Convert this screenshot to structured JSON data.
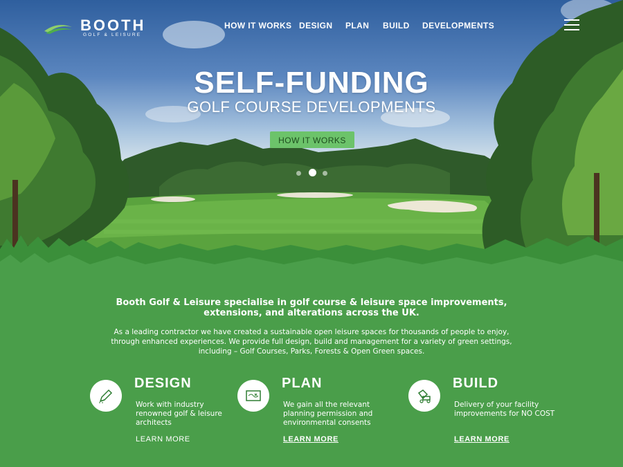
{
  "brand": {
    "name": "BOOTH",
    "tagline": "GOLF & LEISURE"
  },
  "nav": {
    "items": [
      "HOW IT WORKS",
      "DESIGN",
      "PLAN",
      "BUILD",
      "DEVELOPMENTS"
    ]
  },
  "hero": {
    "title": "SELF-FUNDING",
    "subtitle": "GOLF COURSE DEVELOPMENTS",
    "button_label": "HOW IT WORKS",
    "slides_count": 3,
    "active_slide": 2
  },
  "intro": {
    "heading": "Booth Golf & Leisure specialise in golf course & leisure space improvements, extensions, and alterations across the UK.",
    "body": "As a leading contractor we have created a sustainable open leisure spaces for thousands of people to enjoy, through enhanced experiences. We provide full design, build and management for a variety of green settings, including – Golf Courses, Parks, Forests & Open Green spaces."
  },
  "features": [
    {
      "title": "DESIGN",
      "icon": "pencil-icon",
      "description": "Work with industry renowned golf & leisure architects",
      "link": "LEARN MORE"
    },
    {
      "title": "PLAN",
      "icon": "map-icon",
      "description": "We gain all the relevant planning permission and environmental consents",
      "link": "LEARN MORE"
    },
    {
      "title": "BUILD",
      "icon": "tractor-icon",
      "description": "Delivery of your facility improvements for NO COST",
      "link": "LEARN MORE"
    }
  ],
  "colors": {
    "green_bg": "#4a9e4a",
    "button_green": "#6cc36a",
    "text": "#ffffff"
  }
}
